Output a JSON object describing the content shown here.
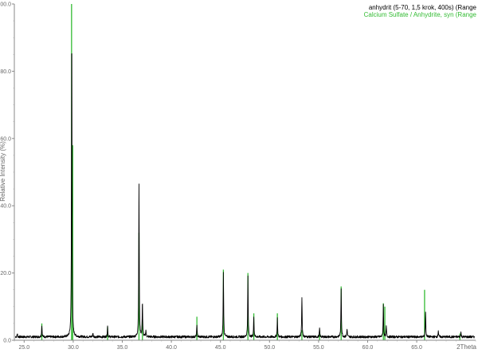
{
  "chart_data": {
    "type": "line",
    "title": "",
    "xlabel": "2Theta",
    "ylabel": "Relative Intensity (%)",
    "xlim": [
      24.0,
      71.0
    ],
    "ylim": [
      0,
      100
    ],
    "x_ticks": [
      25.0,
      30.0,
      35.0,
      40.0,
      45.0,
      50.0,
      55.0,
      60.0,
      65.0
    ],
    "x_tick_labels": [
      "25.0",
      "30.0",
      "35.0",
      "40.0",
      "45.0",
      "50.0",
      "55.0",
      "60.0",
      "65.0"
    ],
    "y_ticks": [
      0,
      20,
      40,
      60,
      80,
      100
    ],
    "y_tick_labels": [
      "0.0",
      "20.0",
      "40.0",
      "60.0",
      "80.0",
      "100.0"
    ],
    "grid": false,
    "legend_position": "top-right",
    "series": [
      {
        "name": "anhydrit (5-70, 1,5 krok, 400s) (Range",
        "color": "#000000",
        "style": "continuous-pattern",
        "background": 1.0,
        "peaks": [
          {
            "x": 24.3,
            "y": 1.0
          },
          {
            "x": 26.8,
            "y": 3.5
          },
          {
            "x": 29.85,
            "y": 93.5
          },
          {
            "x": 32.0,
            "y": 1.2
          },
          {
            "x": 33.5,
            "y": 3.2
          },
          {
            "x": 36.7,
            "y": 45.5
          },
          {
            "x": 37.05,
            "y": 10.5
          },
          {
            "x": 37.4,
            "y": 2.0
          },
          {
            "x": 42.6,
            "y": 3.5
          },
          {
            "x": 45.3,
            "y": 19.0
          },
          {
            "x": 47.8,
            "y": 18.0
          },
          {
            "x": 48.4,
            "y": 6.0
          },
          {
            "x": 50.8,
            "y": 5.5
          },
          {
            "x": 53.3,
            "y": 12.0
          },
          {
            "x": 55.1,
            "y": 2.5
          },
          {
            "x": 57.3,
            "y": 14.5
          },
          {
            "x": 57.9,
            "y": 2.5
          },
          {
            "x": 61.6,
            "y": 9.5
          },
          {
            "x": 61.9,
            "y": 3.0
          },
          {
            "x": 65.9,
            "y": 7.5
          },
          {
            "x": 67.2,
            "y": 2.0
          },
          {
            "x": 69.5,
            "y": 1.5
          }
        ]
      },
      {
        "name": "Calcium Sulfate / Anhydrite, syn (Range",
        "color": "#33bb33",
        "style": "stick-pattern",
        "sticks": [
          {
            "x": 26.8,
            "y": 5.0
          },
          {
            "x": 29.83,
            "y": 100.0
          },
          {
            "x": 29.95,
            "y": 58.0
          },
          {
            "x": 33.5,
            "y": 4.0
          },
          {
            "x": 36.7,
            "y": 32.0
          },
          {
            "x": 37.05,
            "y": 6.0
          },
          {
            "x": 42.6,
            "y": 7.0
          },
          {
            "x": 45.3,
            "y": 21.0
          },
          {
            "x": 47.8,
            "y": 20.0
          },
          {
            "x": 48.4,
            "y": 8.0
          },
          {
            "x": 50.8,
            "y": 8.0
          },
          {
            "x": 53.3,
            "y": 3.0
          },
          {
            "x": 55.1,
            "y": 3.0
          },
          {
            "x": 57.3,
            "y": 16.0
          },
          {
            "x": 61.6,
            "y": 11.0
          },
          {
            "x": 61.75,
            "y": 10.0
          },
          {
            "x": 65.8,
            "y": 15.0
          },
          {
            "x": 69.4,
            "y": 2.0
          }
        ]
      }
    ]
  }
}
